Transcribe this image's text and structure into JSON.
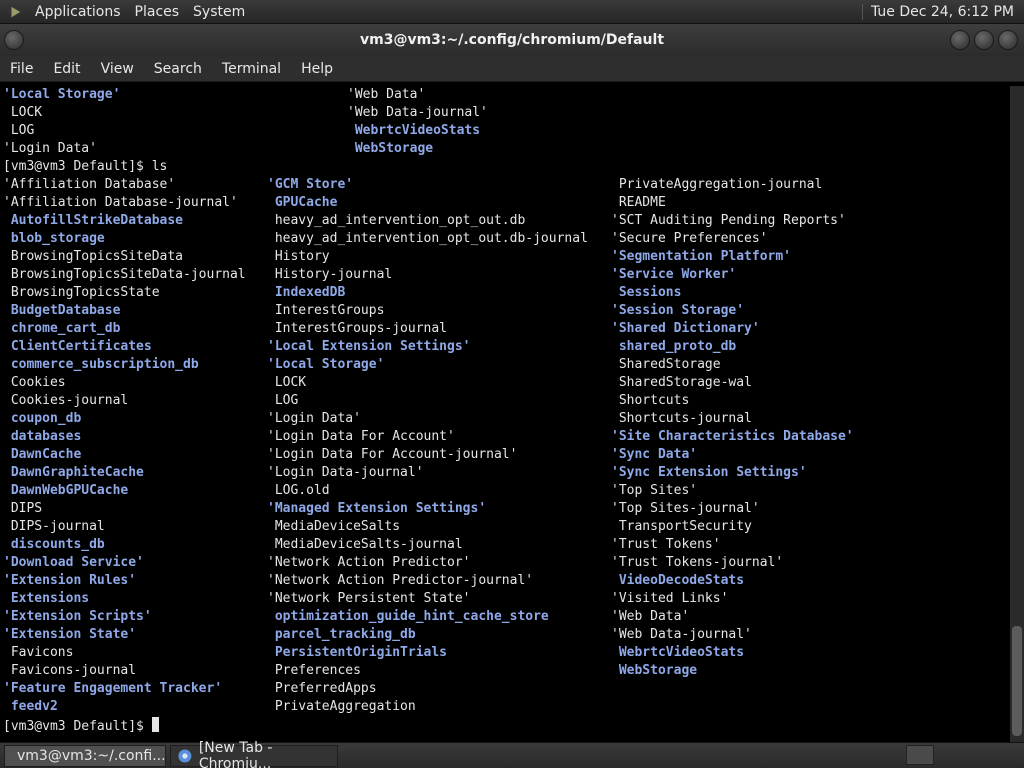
{
  "top_panel": {
    "menus": [
      "Applications",
      "Places",
      "System"
    ],
    "clock": "Tue Dec 24,  6:12 PM"
  },
  "window": {
    "title": "vm3@vm3:~/.config/chromium/Default",
    "menus": [
      "File",
      "Edit",
      "View",
      "Search",
      "Terminal",
      "Help"
    ]
  },
  "terminal": {
    "top_block": [
      [
        {
          "t": "'Local Storage'",
          "d": true
        },
        {
          "t": "'Web Data'",
          "d": false
        }
      ],
      [
        {
          "t": " LOCK",
          "d": false
        },
        {
          "t": "'Web Data-journal'",
          "d": false
        }
      ],
      [
        {
          "t": " LOG",
          "d": false
        },
        {
          "t": " WebrtcVideoStats",
          "d": true
        }
      ],
      [
        {
          "t": "'Login Data'",
          "d": false
        },
        {
          "t": " WebStorage",
          "d": true
        }
      ]
    ],
    "prompt": "[vm3@vm3 Default]$ ",
    "command": "ls",
    "columns": [
      [
        {
          "t": "'Affiliation Database'",
          "d": false
        },
        {
          "t": "'Affiliation Database-journal'",
          "d": false
        },
        {
          "t": " AutofillStrikeDatabase",
          "d": true
        },
        {
          "t": " blob_storage",
          "d": true
        },
        {
          "t": " BrowsingTopicsSiteData",
          "d": false
        },
        {
          "t": " BrowsingTopicsSiteData-journal",
          "d": false
        },
        {
          "t": " BrowsingTopicsState",
          "d": false
        },
        {
          "t": " BudgetDatabase",
          "d": true
        },
        {
          "t": " chrome_cart_db",
          "d": true
        },
        {
          "t": " ClientCertificates",
          "d": true
        },
        {
          "t": " commerce_subscription_db",
          "d": true
        },
        {
          "t": " Cookies",
          "d": false
        },
        {
          "t": " Cookies-journal",
          "d": false
        },
        {
          "t": " coupon_db",
          "d": true
        },
        {
          "t": " databases",
          "d": true
        },
        {
          "t": " DawnCache",
          "d": true
        },
        {
          "t": " DawnGraphiteCache",
          "d": true
        },
        {
          "t": " DawnWebGPUCache",
          "d": true
        },
        {
          "t": " DIPS",
          "d": false
        },
        {
          "t": " DIPS-journal",
          "d": false
        },
        {
          "t": " discounts_db",
          "d": true
        },
        {
          "t": "'Download Service'",
          "d": true
        },
        {
          "t": "'Extension Rules'",
          "d": true
        },
        {
          "t": " Extensions",
          "d": true
        },
        {
          "t": "'Extension Scripts'",
          "d": true
        },
        {
          "t": "'Extension State'",
          "d": true
        },
        {
          "t": " Favicons",
          "d": false
        },
        {
          "t": " Favicons-journal",
          "d": false
        },
        {
          "t": "'Feature Engagement Tracker'",
          "d": true
        },
        {
          "t": " feedv2",
          "d": true
        }
      ],
      [
        {
          "t": "'GCM Store'",
          "d": true
        },
        {
          "t": " GPUCache",
          "d": true
        },
        {
          "t": " heavy_ad_intervention_opt_out.db",
          "d": false
        },
        {
          "t": " heavy_ad_intervention_opt_out.db-journal",
          "d": false
        },
        {
          "t": " History",
          "d": false
        },
        {
          "t": " History-journal",
          "d": false
        },
        {
          "t": " IndexedDB",
          "d": true
        },
        {
          "t": " InterestGroups",
          "d": false
        },
        {
          "t": " InterestGroups-journal",
          "d": false
        },
        {
          "t": "'Local Extension Settings'",
          "d": true
        },
        {
          "t": "'Local Storage'",
          "d": true
        },
        {
          "t": " LOCK",
          "d": false
        },
        {
          "t": " LOG",
          "d": false
        },
        {
          "t": "'Login Data'",
          "d": false
        },
        {
          "t": "'Login Data For Account'",
          "d": false
        },
        {
          "t": "'Login Data For Account-journal'",
          "d": false
        },
        {
          "t": "'Login Data-journal'",
          "d": false
        },
        {
          "t": " LOG.old",
          "d": false
        },
        {
          "t": "'Managed Extension Settings'",
          "d": true
        },
        {
          "t": " MediaDeviceSalts",
          "d": false
        },
        {
          "t": " MediaDeviceSalts-journal",
          "d": false
        },
        {
          "t": "'Network Action Predictor'",
          "d": false
        },
        {
          "t": "'Network Action Predictor-journal'",
          "d": false
        },
        {
          "t": "'Network Persistent State'",
          "d": false
        },
        {
          "t": " optimization_guide_hint_cache_store",
          "d": true
        },
        {
          "t": " parcel_tracking_db",
          "d": true
        },
        {
          "t": " PersistentOriginTrials",
          "d": true
        },
        {
          "t": " Preferences",
          "d": false
        },
        {
          "t": " PreferredApps",
          "d": false
        },
        {
          "t": " PrivateAggregation",
          "d": false
        }
      ],
      [
        {
          "t": " PrivateAggregation-journal",
          "d": false
        },
        {
          "t": " README",
          "d": false
        },
        {
          "t": "'SCT Auditing Pending Reports'",
          "d": false
        },
        {
          "t": "'Secure Preferences'",
          "d": false
        },
        {
          "t": "'Segmentation Platform'",
          "d": true
        },
        {
          "t": "'Service Worker'",
          "d": true
        },
        {
          "t": " Sessions",
          "d": true
        },
        {
          "t": "'Session Storage'",
          "d": true
        },
        {
          "t": "'Shared Dictionary'",
          "d": true
        },
        {
          "t": " shared_proto_db",
          "d": true
        },
        {
          "t": " SharedStorage",
          "d": false
        },
        {
          "t": " SharedStorage-wal",
          "d": false
        },
        {
          "t": " Shortcuts",
          "d": false
        },
        {
          "t": " Shortcuts-journal",
          "d": false
        },
        {
          "t": "'Site Characteristics Database'",
          "d": true
        },
        {
          "t": "'Sync Data'",
          "d": true
        },
        {
          "t": "'Sync Extension Settings'",
          "d": true
        },
        {
          "t": "'Top Sites'",
          "d": false
        },
        {
          "t": "'Top Sites-journal'",
          "d": false
        },
        {
          "t": " TransportSecurity",
          "d": false
        },
        {
          "t": "'Trust Tokens'",
          "d": false
        },
        {
          "t": "'Trust Tokens-journal'",
          "d": false
        },
        {
          "t": " VideoDecodeStats",
          "d": true
        },
        {
          "t": "'Visited Links'",
          "d": false
        },
        {
          "t": "'Web Data'",
          "d": false
        },
        {
          "t": "'Web Data-journal'",
          "d": false
        },
        {
          "t": " WebrtcVideoStats",
          "d": true
        },
        {
          "t": " WebStorage",
          "d": true
        }
      ]
    ],
    "final_prompt": "[vm3@vm3 Default]$ "
  },
  "taskbar": {
    "tasks": [
      {
        "label": "vm3@vm3:~/.confi...",
        "active": true
      },
      {
        "label": "[New Tab - Chromiu...",
        "active": false
      }
    ]
  },
  "colors": {
    "directory": "#8fa9e8",
    "text": "#e6e6e6",
    "background": "#000000"
  }
}
